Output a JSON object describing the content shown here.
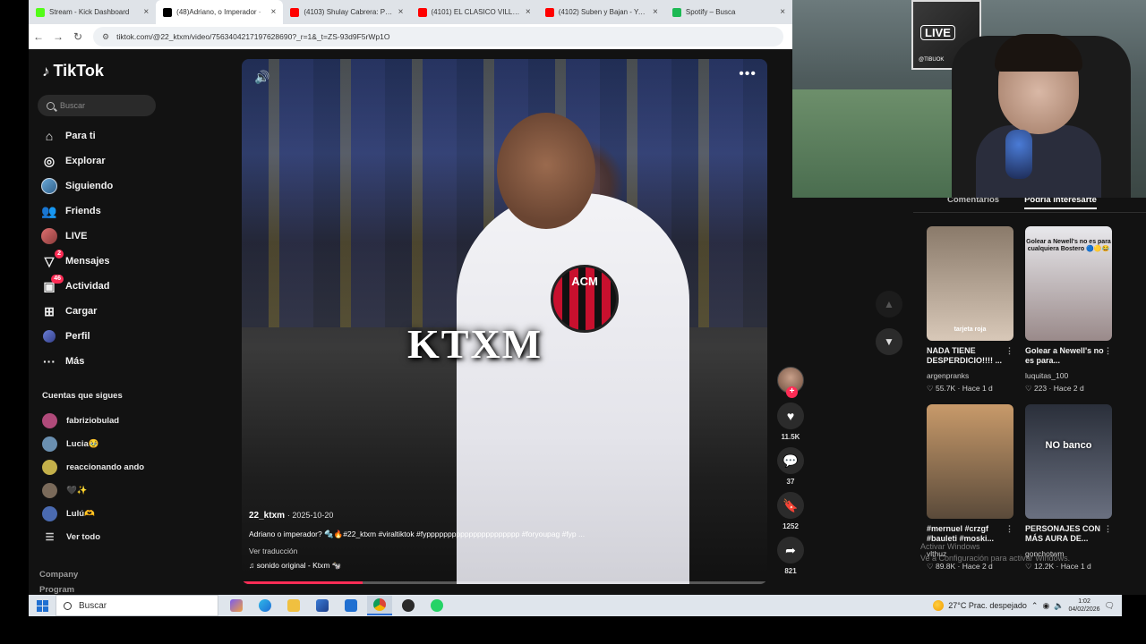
{
  "browser": {
    "tabs": [
      {
        "title": "Stream - Kick Dashboard",
        "color": "#53fc18",
        "active": false
      },
      {
        "title": "(48)Adriano, o Imperador ·",
        "color": "#000000",
        "active": true
      },
      {
        "title": "(4103) Shulay Cabrera: POR LA",
        "color": "#ff0000",
        "active": false
      },
      {
        "title": "(4101) EL CLASICO VILLERO DE",
        "color": "#ff0000",
        "active": false
      },
      {
        "title": "(4102) Suben y Bajan - YouTube",
        "color": "#ff0000",
        "active": false
      },
      {
        "title": "Spotify – Busca",
        "color": "#1db954",
        "active": false
      }
    ],
    "url": "tiktok.com/@22_ktxm/video/7563404217197628690?_r=1&_t=ZS-93d9F5rWp1O"
  },
  "sidebar": {
    "logo": "TikTok",
    "search_placeholder": "Buscar",
    "nav": [
      {
        "label": "Para ti",
        "icon": "home-icon",
        "badge": ""
      },
      {
        "label": "Explorar",
        "icon": "compass-icon",
        "badge": ""
      },
      {
        "label": "Siguiendo",
        "icon": "following-avatar-icon",
        "badge": ""
      },
      {
        "label": "Friends",
        "icon": "friends-icon",
        "badge": ""
      },
      {
        "label": "LIVE",
        "icon": "live-avatar-icon",
        "badge": ""
      },
      {
        "label": "Mensajes",
        "icon": "messages-icon",
        "badge": "2"
      },
      {
        "label": "Actividad",
        "icon": "activity-icon",
        "badge": "46"
      },
      {
        "label": "Cargar",
        "icon": "upload-icon",
        "badge": ""
      },
      {
        "label": "Perfil",
        "icon": "profile-avatar-icon",
        "badge": ""
      },
      {
        "label": "Más",
        "icon": "more-icon",
        "badge": ""
      }
    ],
    "following_header": "Cuentas que sigues",
    "following": [
      {
        "name": "fabriziobulad",
        "color": "#b04a7a"
      },
      {
        "name": "Lucia🥹",
        "color": "#6a8fb0"
      },
      {
        "name": "reaccionando ando",
        "color": "#c4b04a"
      },
      {
        "name": "🖤✨",
        "color": "#7a6a5a"
      },
      {
        "name": "Lulú🫶",
        "color": "#4a6ab0"
      }
    ],
    "see_all": "Ver todo",
    "company": "Company",
    "program": "Program"
  },
  "video": {
    "watermark": "KTXM",
    "crest": "ACM",
    "author": "22_ktxm",
    "date": "2025-10-20",
    "caption": "Adriano o imperador? 🔩🔥#22_ktxm #viraltiktok #fypppppppppppppppppppppp #foryoupag #fyp ...",
    "translate": "Ver traducción",
    "music": "sonido original - Ktxm 🐄",
    "progress": 0.23
  },
  "actions": {
    "likes": "11.5K",
    "comments": "37",
    "saves": "1252",
    "shares": "821"
  },
  "right": {
    "tabs": [
      "Comentarios",
      "Podría interesarte"
    ],
    "active_tab": 1,
    "recs": [
      {
        "title": "NADA TIENE DESPERDICIO!!!! ...",
        "user": "argenpranks",
        "stats": "♡ 55.7K · Hace 1 d",
        "overlay": "tarjeta roja",
        "c1": "#8a7a6a",
        "c2": "#d8c8b8"
      },
      {
        "title": "Golear a Newell's no es para...",
        "user": "luquitas_100",
        "stats": "♡ 223 · Hace 2 d",
        "overlay": "Golear a Newell's no es para cualquiera Bostero 🔵🟡😂",
        "c1": "#e8e8ec",
        "c2": "#9a8a8a"
      },
      {
        "title": "#mernuel #crzgf #bauleti #moski...",
        "user": "vlthuz",
        "stats": "♡ 89.8K · Hace 2 d",
        "overlay": "",
        "c1": "#c89a6a",
        "c2": "#5a4a3a"
      },
      {
        "title": "PERSONAJES CON MÁS AURA DE...",
        "user": "gonchotwm",
        "stats": "♡ 12.2K · Hace 1 d",
        "overlay": "NO banco",
        "c1": "#2a2f3a",
        "c2": "#6a7080"
      }
    ],
    "activate_line1": "Activar Windows",
    "activate_line2": "Ve a Configuración para activar Windows."
  },
  "webcam": {
    "poster_text": "LIVE",
    "poster_tag": "@TIBUOK"
  },
  "taskbar": {
    "search": "Buscar",
    "weather": "27°C  Prac. despejado",
    "time": "1:02",
    "date": "04/02/2026"
  }
}
